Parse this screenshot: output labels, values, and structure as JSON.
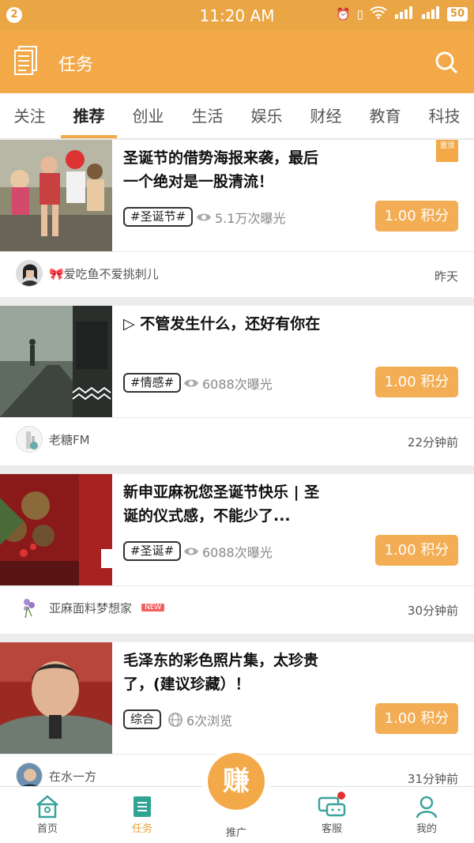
{
  "status": {
    "badge": "2",
    "time": "11:20 AM",
    "battery": "50"
  },
  "header": {
    "title": "任务"
  },
  "tabs": [
    "关注",
    "推荐",
    "创业",
    "生活",
    "娱乐",
    "财经",
    "教育",
    "科技"
  ],
  "active_tab": "推荐",
  "pinned_label": "置顶",
  "cards": [
    {
      "title": "圣诞节的借势海报来袭，最后一个绝对是一股清流！",
      "tag": "#圣诞节#",
      "views": "5.1万次曝光",
      "points": "1.00 积分",
      "author": "🎀爱吃鱼不爱挑刺儿",
      "time": "昨天"
    },
    {
      "title": "▷ 不管发生什么，还好有你在",
      "tag": "#情感#",
      "views": "6088次曝光",
      "points": "1.00 积分",
      "author": "老糖FM",
      "time": "22分钟前"
    },
    {
      "title": "新申亚麻祝您圣诞节快乐 | 圣诞的仪式感，不能少了...",
      "tag": "#圣诞#",
      "views": "6088次曝光",
      "points": "1.00 积分",
      "author": "亚麻面料梦想家",
      "badge": "NEW",
      "time": "30分钟前"
    },
    {
      "title": "毛泽东的彩色照片集，太珍贵了，(建议珍藏）！",
      "tag": "综合",
      "views": "6次浏览",
      "points": "1.00 积分",
      "author": "在水一方",
      "time": "31分钟前"
    }
  ],
  "nav": {
    "home": "首页",
    "tasks": "任务",
    "earn_icon": "赚",
    "promote": "推广",
    "service": "客服",
    "mine": "我的"
  }
}
